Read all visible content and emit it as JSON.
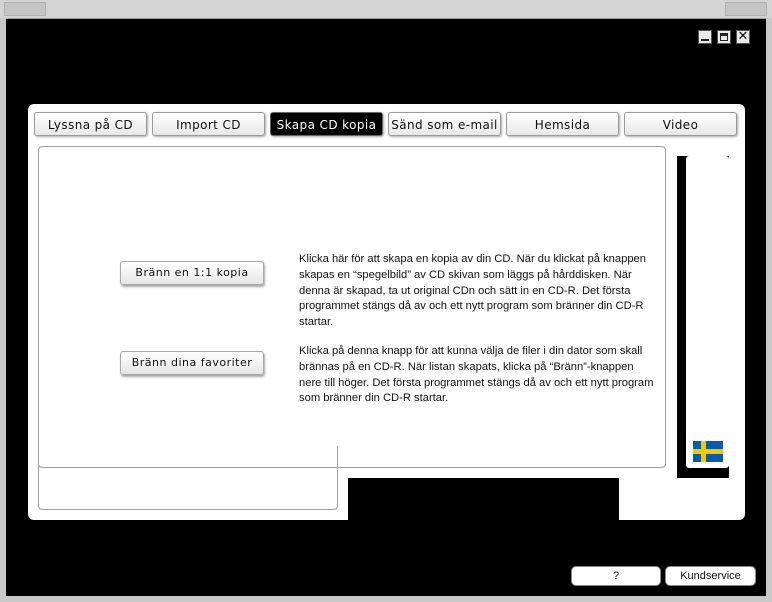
{
  "tabs": [
    {
      "label": "Lyssna på CD",
      "active": false
    },
    {
      "label": "Import CD",
      "active": false
    },
    {
      "label": "Skapa CD kopia",
      "active": true
    },
    {
      "label": "Sänd som e-mail",
      "active": false
    },
    {
      "label": "Hemsida",
      "active": false
    },
    {
      "label": "Video",
      "active": false
    }
  ],
  "copy_section": {
    "button_label": "Bränn en 1:1 kopia",
    "description": "Klicka här för att skapa en kopia av din CD. När du klickat på knappen skapas en “spegelbild” av CD skivan som läggs på hårddisken. När denna är skapad, ta ut original CDn och sätt in en CD-R. Det första programmet stängs då av och ett nytt program som bränner din CD-R startar."
  },
  "favorites_section": {
    "button_label": "Bränn dina favoriter",
    "description": "Klicka på denna knapp för att kunna välja de filer i din dator som skall brännas på en CD-R. När listan skapats, klicka på “Bränn”-knappen nere till höger. Det första programmet stängs då av och ett nytt program som bränner din CD-R startar."
  },
  "footer": {
    "help_label": "?",
    "support_label": "Kundservice"
  },
  "icons": {
    "minimize": "minimize-icon",
    "maximize": "maximize-icon",
    "close": "close-icon",
    "language_flag": "swedish-flag-icon"
  },
  "colors": {
    "background": "#000000",
    "panel": "#ffffff",
    "active_tab": "#000000",
    "flag_blue": "#0a5aa8",
    "flag_yellow": "#f2c800"
  }
}
